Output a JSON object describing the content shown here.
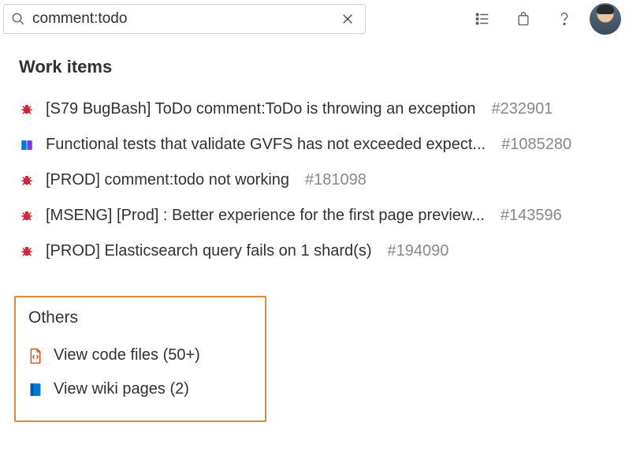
{
  "search": {
    "value": "comment:todo",
    "placeholder": ""
  },
  "sections": {
    "workItems": {
      "title": "Work items",
      "items": [
        {
          "icon": "bug",
          "title": "[S79 BugBash] ToDo comment:ToDo is throwing an exception",
          "id": "#232901"
        },
        {
          "icon": "book",
          "title": "Functional tests that validate GVFS has not exceeded expect...",
          "id": "#1085280"
        },
        {
          "icon": "bug",
          "title": "[PROD] comment:todo not working",
          "id": "#181098"
        },
        {
          "icon": "bug",
          "title": "[MSENG] [Prod] : Better experience for the first page preview...",
          "id": "#143596"
        },
        {
          "icon": "bug",
          "title": "[PROD] Elasticsearch query fails on 1 shard(s)",
          "id": "#194090"
        }
      ]
    },
    "others": {
      "title": "Others",
      "items": [
        {
          "icon": "code-file",
          "label": "View code files (50+)"
        },
        {
          "icon": "wiki",
          "label": "View wiki pages (2)"
        }
      ]
    }
  }
}
